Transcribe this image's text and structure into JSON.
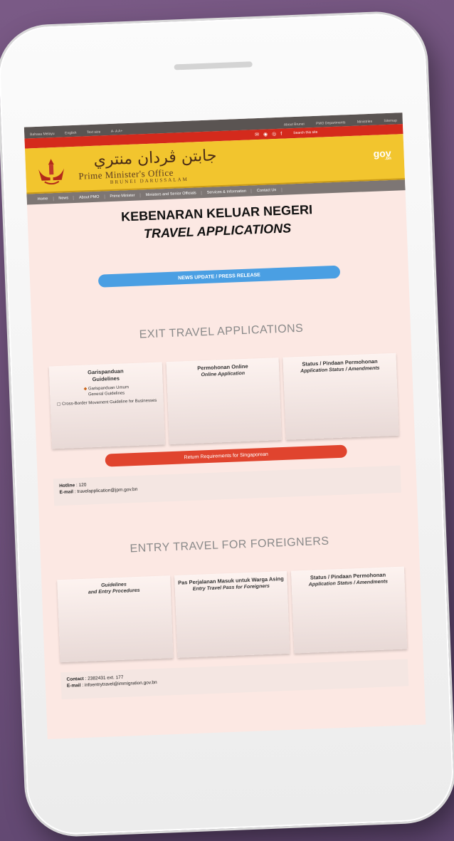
{
  "topbar": {
    "left": [
      "Bahasa Melayu",
      "English",
      "Text size",
      "A- A A+"
    ],
    "right": [
      "About Brunei",
      "PMO Departments",
      "Ministries",
      "Sitemap"
    ]
  },
  "redbar": {
    "search_placeholder": "Search this site"
  },
  "header": {
    "jawi": "جابتن ڤردان منتري",
    "title": "Prime Minister's Office",
    "subtitle": "BRUNEI DARUSSALAM",
    "gov_logo": "gov",
    "gov_sub": ".bn"
  },
  "nav": [
    "Home",
    "News",
    "About PMO",
    "Prime Minister",
    "Ministers and Senior Officials",
    "Services & Information",
    "Contact Us"
  ],
  "page": {
    "title_ms": "KEBENARAN KELUAR NEGERI",
    "title_en": "TRAVEL APPLICATIONS",
    "news_button": "NEWS UPDATE / PRESS RELEASE",
    "exit_heading": "EXIT TRAVEL APPLICATIONS",
    "exit_cards": [
      {
        "title_ms": "Garispanduan",
        "title_en": "Guidelines",
        "links": [
          "Garispanduan Umum",
          "General Guidelines",
          "Cross-Border Movement Guideline for Businesses"
        ]
      },
      {
        "title_ms": "Permohonan Online",
        "title_en": "Online Application"
      },
      {
        "title_ms": "Status / Pindaan Permohonan",
        "title_en": "Application Status / Amendments"
      }
    ],
    "return_button": "Return Requirements for Singaporean",
    "exit_contact": {
      "hotline_label": "Hotline",
      "hotline": ": 120",
      "email_label": "E-mail",
      "email": ": travelapplication@jpm.gov.bn"
    },
    "entry_heading": "ENTRY TRAVEL FOR FOREIGNERS",
    "entry_cards": [
      {
        "title_ms": "Guidelines",
        "title_en": "and Entry Procedures"
      },
      {
        "title_ms": "Pas Perjalanan Masuk untuk Warga Asing",
        "title_en": "Entry Travel Pass for Foreigners"
      },
      {
        "title_ms": "Status / Pindaan Permohonan",
        "title_en": "Application Status / Amendments"
      }
    ],
    "entry_contact": {
      "contact_label": "Contact",
      "contact": ": 2382431 ext. 177",
      "email_label": "E-mail",
      "email": ": infoentrytravel@immigration.gov.bn"
    }
  }
}
